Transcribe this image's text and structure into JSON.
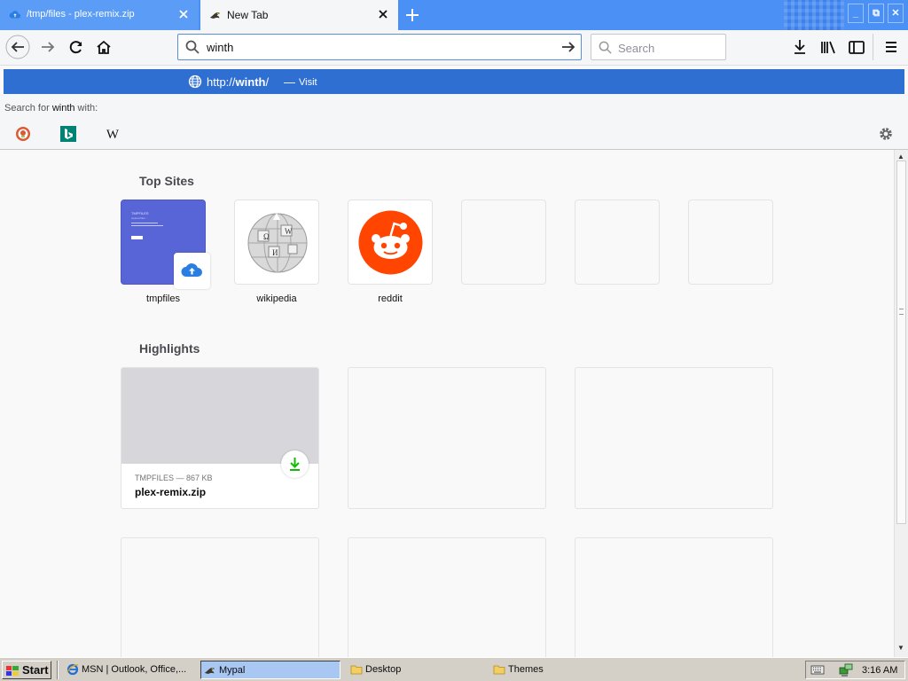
{
  "tabs": [
    {
      "title": "/tmp/files - plex-remix.zip",
      "icon": "cloud-upload-icon",
      "active": false
    },
    {
      "title": "New Tab",
      "icon": "mypal-logo-icon",
      "active": true
    }
  ],
  "toolbar": {
    "url_value": "winth",
    "search_placeholder": "Search"
  },
  "autocomplete": {
    "visit_url_prefix": "http://",
    "visit_url_bold": "winth",
    "visit_url_suffix": "/",
    "visit_sep": "—",
    "visit_action": "Visit",
    "search_with_prefix": "Search for ",
    "search_with_term": "winth",
    "search_with_suffix": " with:",
    "engines": [
      "duckduckgo-icon",
      "bing-icon",
      "wikipedia-icon"
    ]
  },
  "newtab": {
    "top_sites_title": "Top Sites",
    "top_sites": [
      {
        "label": "tmpfiles",
        "thumb_title": "TMPFILES",
        "thumb_sub": "Upload files ...",
        "badge": "cloud-upload-icon"
      },
      {
        "label": "wikipedia",
        "icon": "wikipedia-globe-icon"
      },
      {
        "label": "reddit",
        "icon": "reddit-icon"
      },
      {
        "label": ""
      },
      {
        "label": ""
      },
      {
        "label": ""
      }
    ],
    "highlights_title": "Highlights",
    "highlights": [
      {
        "source": "TMPFILES — 867 KB",
        "title": "plex-remix.zip",
        "badge": "download-icon"
      }
    ]
  },
  "taskbar": {
    "start_label": "Start",
    "items": [
      {
        "label": "MSN | Outlook, Office,...",
        "active": false
      },
      {
        "label": "Mypal",
        "active": true
      },
      {
        "label": "Desktop",
        "active": false
      },
      {
        "label": "Themes",
        "active": false
      }
    ],
    "clock": "3:16 AM"
  },
  "colors": {
    "tabstrip": "#4a90f5",
    "visit_row": "#2f6fd1",
    "reddit": "#ff4500",
    "tmpfiles_tile": "#5865d6",
    "download_green": "#12bc00"
  }
}
